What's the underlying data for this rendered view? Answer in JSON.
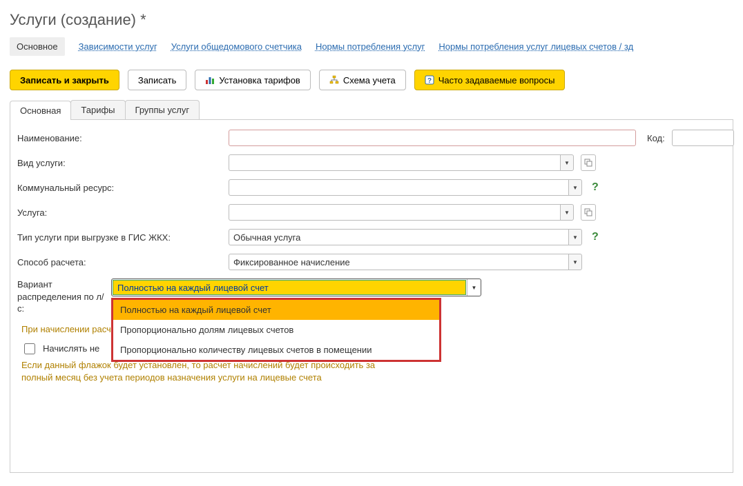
{
  "title": "Услуги (создание) *",
  "nav": {
    "active": "Основное",
    "links": [
      "Зависимости услуг",
      "Услуги общедомового счетчика",
      "Нормы потребления услуг",
      "Нормы потребления услуг лицевых счетов / зд"
    ]
  },
  "toolbar": {
    "save_close": "Записать и закрыть",
    "save": "Записать",
    "tariffs": "Установка тарифов",
    "scheme": "Схема учета",
    "faq": "Часто задаваемые вопросы"
  },
  "tabs": [
    "Основная",
    "Тарифы",
    "Группы услуг"
  ],
  "active_tab": 0,
  "form": {
    "name_label": "Наименование:",
    "code_label": "Код:",
    "service_kind_label": "Вид услуги:",
    "communal_res_label": "Коммунальный ресурс:",
    "service_label": "Услуга:",
    "gis_type_label": "Тип услуги при выгрузке в ГИС ЖКХ:",
    "gis_type_value": "Обычная услуга",
    "calc_method_label": "Способ расчета:",
    "calc_method_value": "Фиксированное начисление",
    "distribution_label": "Вариант распределения по л/с:",
    "distribution_value": "Полностью на каждый лицевой счет",
    "distribution_options": [
      "Полностью на каждый лицевой счет",
      "Пропорционально долям лицевых счетов",
      "Пропорционально количеству лицевых счетов в помещении"
    ],
    "hint1": "При начислении расчет будет пр",
    "checkbox_label": "Начислять не",
    "hint2": "Если данный флажок будет установлен, то расчет начислений будет происходить за полный месяц без учета периодов назначения услуги на лицевые счета"
  }
}
